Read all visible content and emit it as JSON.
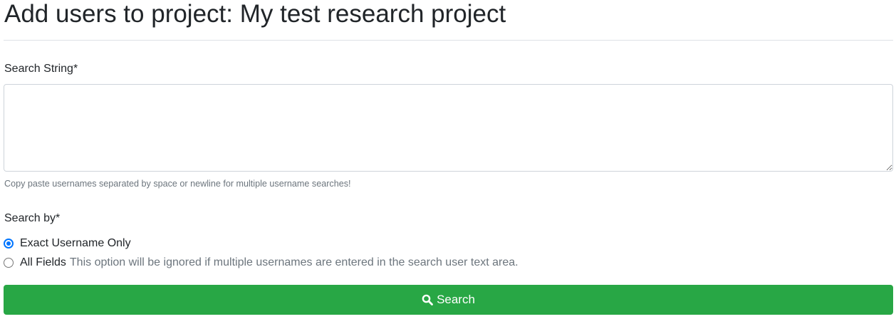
{
  "header": {
    "title": "Add users to project: My test research project"
  },
  "form": {
    "search_string_label": "Search String*",
    "search_string_value": "",
    "help_text": "Copy paste usernames separated by space or newline for multiple username searches!",
    "search_by_label": "Search by*",
    "options": [
      {
        "label": "Exact Username Only",
        "note": "",
        "selected": true
      },
      {
        "label": "All Fields",
        "note": "This option will be ignored if multiple usernames are entered in the search user text area.",
        "selected": false
      }
    ],
    "submit_label": "Search",
    "submit_icon": "search-icon"
  },
  "colors": {
    "button_bg": "#28a745",
    "radio_accent": "#0075ff",
    "muted_text": "#6c757d"
  }
}
